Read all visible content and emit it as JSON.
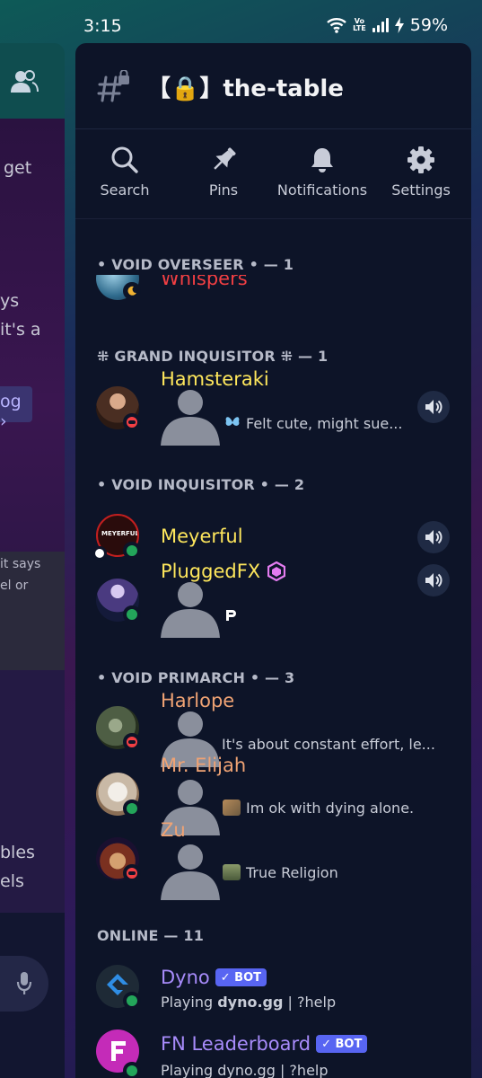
{
  "status_bar": {
    "time": "3:15",
    "network_label_top": "Vo",
    "network_label_bottom": "LTE",
    "battery": "59%"
  },
  "background_chat": {
    "line1": "get",
    "line2": "ys",
    "line3": "it's a",
    "chip": "og ›",
    "card_line1": "it says",
    "card_line2": "el or",
    "lower_line1": "bles",
    "lower_line2": "els"
  },
  "channel": {
    "name": "【🔒】the-table"
  },
  "toolbar": {
    "search_label": "Search",
    "pins_label": "Pins",
    "notifications_label": "Notifications",
    "settings_label": "Settings"
  },
  "sections": {
    "void_overseer": "• VOID OVERSEER • — 1",
    "grand_inquisitor": "⁜ GRAND INQUISITOR ⁜ — 1",
    "void_inquisitor": "• VOID INQUISITOR • — 2",
    "void_primarch": "• VOID PRIMARCH • — 3",
    "online": "ONLINE — 11"
  },
  "members": {
    "whispers": {
      "name": "Whispers",
      "color": "#f23f43",
      "status": "idle"
    },
    "hamsteraki": {
      "name": "Hamsteraki",
      "color": "#fee75c",
      "activity": "Felt cute, might sue...",
      "status": "dnd"
    },
    "meyerful": {
      "name": "Meyerful",
      "color": "#fee75c",
      "avatar_text": "MEYERFUL",
      "status": "online"
    },
    "pluggedfx": {
      "name": "PluggedFX",
      "color": "#fee75c",
      "activity": "",
      "status": "online"
    },
    "harlope": {
      "name": "Harlope",
      "color": "#f0a374",
      "activity": "It's about constant effort, le...",
      "status": "dnd"
    },
    "mr_elijah": {
      "name": "Mr. Elijah",
      "color": "#f0a374",
      "activity": "Im ok with dying alone.",
      "status": "online"
    },
    "zu": {
      "name": "Zu",
      "color": "#f0a374",
      "activity": "True Religion",
      "status": "dnd"
    },
    "dyno": {
      "name": "Dyno",
      "color": "#a78bfa",
      "bot_tag": "✓ BOT",
      "activity_prefix": "Playing ",
      "activity_bold": "dyno.gg",
      "activity_suffix": " | ?help",
      "status": "online"
    },
    "fn_leaderboard": {
      "name": "FN Leaderboard",
      "color": "#a78bfa",
      "bot_tag": "✓ BOT",
      "activity": "Playing dyno.gg | ?help",
      "status": "online"
    }
  },
  "icons": [
    "friends-icon",
    "hash-lock-icon",
    "search-icon",
    "pin-icon",
    "bell-icon",
    "gear-icon",
    "speaker-icon",
    "mic-icon"
  ],
  "colors": {
    "drawer_bg": "#0d1428",
    "online": "#23a55a",
    "dnd": "#f23f43",
    "idle": "#f0b232",
    "bot_tag": "#5865f2"
  }
}
